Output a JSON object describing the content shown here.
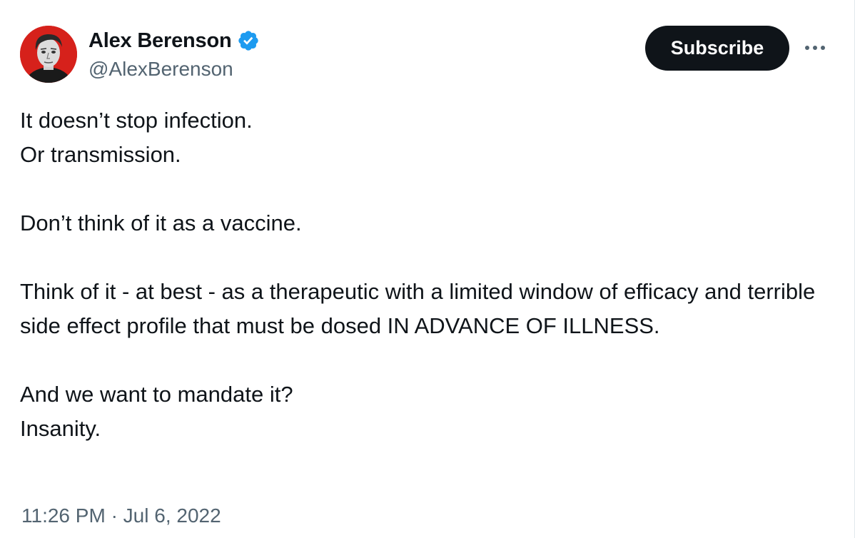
{
  "author": {
    "display_name": "Alex Berenson",
    "handle": "@AlexBerenson",
    "verified": true
  },
  "actions": {
    "subscribe_label": "Subscribe",
    "more_icon": "more-horizontal-icon"
  },
  "tweet": {
    "lines": [
      "It doesn’t stop infection.",
      "Or transmission.",
      "Don’t think of it as a vaccine.",
      "Think of it - at best - as a therapeutic with a limited window of efficacy and terrible side effect profile that must be dosed IN ADVANCE OF ILLNESS.",
      "And we want to mandate it?",
      "Insanity."
    ]
  },
  "meta": {
    "time": "11:26 PM",
    "separator": "·",
    "date": "Jul 6, 2022"
  },
  "colors": {
    "text_primary": "#0f1419",
    "text_secondary": "#536471",
    "verified_blue": "#1d9bf0",
    "button_bg": "#0f1419",
    "avatar_bg": "#d6211b"
  }
}
